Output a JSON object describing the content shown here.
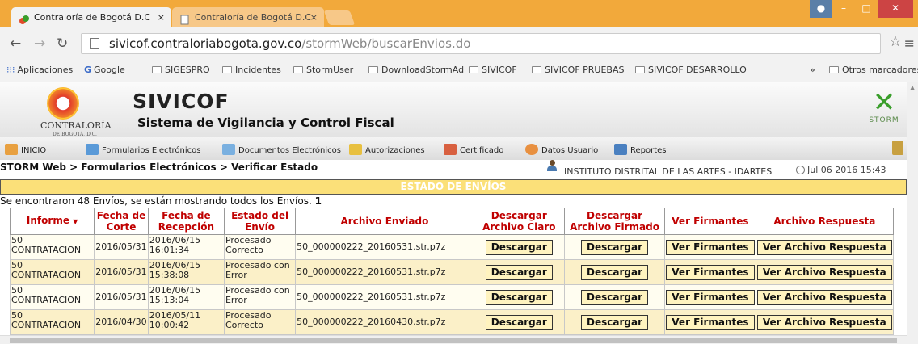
{
  "browser": {
    "tabs": [
      {
        "label": "Contraloría de Bogotá D.C",
        "close": "×"
      },
      {
        "label": "Contraloría de Bogotá D.C",
        "close": "×"
      }
    ],
    "url_host": "sivicof.contraloriabogota.gov.co",
    "url_path": "/stormWeb/buscarEnvios.do",
    "bookmarks": [
      "Aplicaciones",
      "Google",
      "SIGESPRO",
      "Incidentes",
      "StormUser",
      "DownloadStormAdmi",
      "SIVICOF",
      "SIVICOF PRUEBAS",
      "SIVICOF DESARROLLO"
    ],
    "overflow": "»",
    "other_bookmarks": "Otros marcadores"
  },
  "header": {
    "logo_text": "CONTRALORÍA",
    "logo_sub": "DE BOGOTÁ, D.C.",
    "title": "SIVICOF",
    "subtitle": "Sistema de Vigilancia y Control Fiscal",
    "storm_text": "STORM"
  },
  "nav": [
    "INICIO",
    "Formularios Electrónicos",
    "Documentos Electrónicos",
    "Autorizaciones",
    "Certificado",
    "Datos Usuario",
    "Reportes"
  ],
  "breadcrumb": "STORM Web > Formularios Electrónicos > Verificar Estado",
  "institution": "INSTITUTO DISTRITAL DE LAS ARTES - IDARTES",
  "datetime": "Jul 06 2016 15:43",
  "status_title": "ESTADO DE ENVÍOS",
  "found_text": "Se encontraron 48 Envíos, se están mostrando todos los Envíos.",
  "found_page": "1",
  "table": {
    "headers": [
      "Informe",
      "Fecha de Corte",
      "Fecha de Recepción",
      "Estado del Envío",
      "Archivo Enviado",
      "Descargar Archivo Claro",
      "Descargar Archivo Firmado",
      "Ver Firmantes",
      "Archivo Respuesta"
    ],
    "sort_indicator": "▼",
    "rows": [
      {
        "informe": "50 CONTRATACION",
        "corte": "2016/05/31",
        "recepcion": "2016/06/15 16:01:34",
        "estado": "Procesado Correcto",
        "archivo": "50_000000222_20160531.str.p7z",
        "b1": "Descargar",
        "b2": "Descargar",
        "b3": "Ver Firmantes",
        "b4": "Ver Archivo Respuesta"
      },
      {
        "informe": "50 CONTRATACION",
        "corte": "2016/05/31",
        "recepcion": "2016/06/15 15:38:08",
        "estado": "Procesado con Error",
        "archivo": "50_000000222_20160531.str.p7z",
        "b1": "Descargar",
        "b2": "Descargar",
        "b3": "Ver Firmantes",
        "b4": "Ver Archivo Respuesta"
      },
      {
        "informe": "50 CONTRATACION",
        "corte": "2016/05/31",
        "recepcion": "2016/06/15 15:13:04",
        "estado": "Procesado con Error",
        "archivo": "50_000000222_20160531.str.p7z",
        "b1": "Descargar",
        "b2": "Descargar",
        "b3": "Ver Firmantes",
        "b4": "Ver Archivo Respuesta"
      },
      {
        "informe": "50 CONTRATACION",
        "corte": "2016/04/30",
        "recepcion": "2016/05/11 10:00:42",
        "estado": "Procesado Correcto",
        "archivo": "50_000000222_20160430.str.p7z",
        "b1": "Descargar",
        "b2": "Descargar",
        "b3": "Ver Firmantes",
        "b4": "Ver Archivo Respuesta"
      }
    ]
  },
  "colors": {
    "brand_orange": "#f2a93b",
    "status_bar": "#fbe079",
    "header_red": "#c00000",
    "row_alt": "#fbf0c8"
  }
}
